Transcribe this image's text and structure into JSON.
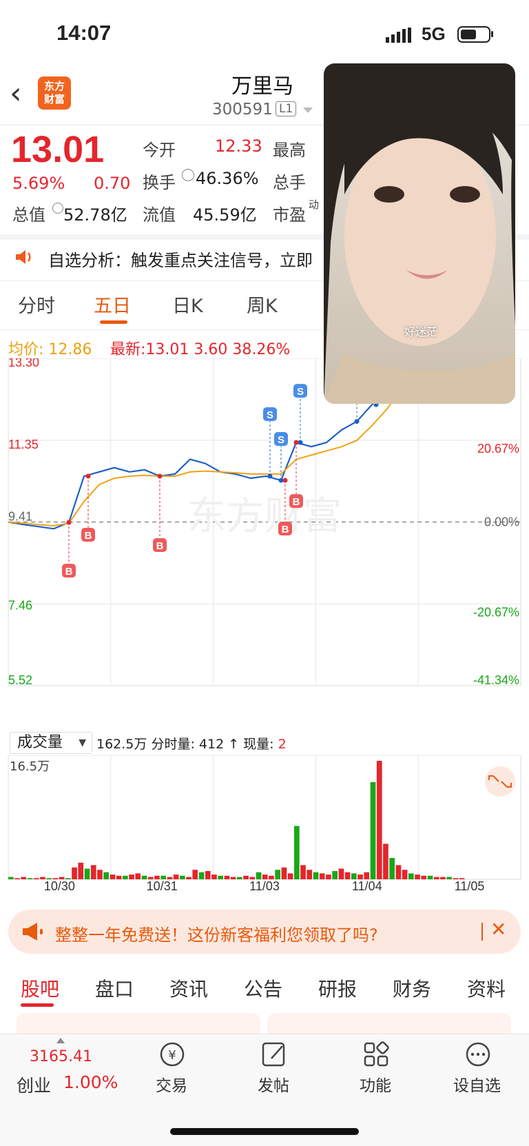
{
  "status_bar": {
    "time": "14:07",
    "network": "5G"
  },
  "header": {
    "logo_text": "东方财富",
    "stock_name": "万里马",
    "stock_code": "300591",
    "level": "L1"
  },
  "quote": {
    "price": "13.01",
    "change_pct": "5.69%",
    "change_abs": "0.70",
    "open_label": "今开",
    "open": "12.33",
    "high_label": "最高",
    "turnover_label": "换手",
    "turnover": "46.36%",
    "volume_label": "总手",
    "mcap_label": "总值",
    "mcap": "52.78亿",
    "float_label": "流值",
    "float_val": "45.59亿",
    "pe_label": "市盈",
    "pe_sup": "动"
  },
  "info_banner": {
    "text": "自选分析：触发重点关注信号，立即"
  },
  "chart_tabs": [
    "分时",
    "五日",
    "日K",
    "周K"
  ],
  "chart_header": {
    "avg_label": "均价:",
    "avg": "12.86",
    "latest_label": "最新:",
    "latest": "13.01",
    "change": "3.60",
    "change_pct": "38.26%"
  },
  "chart_data": {
    "type": "line",
    "x_labels": [
      "10/30",
      "10/31",
      "11/03",
      "11/04",
      "11/05"
    ],
    "y_left_ticks": [
      "13.30",
      "11.35",
      "9.41",
      "7.46",
      "5.52"
    ],
    "y_right_ticks": [
      "20.67%",
      "0.00%",
      "-20.67%",
      "-41.34%"
    ],
    "ylim": [
      5.52,
      13.3
    ],
    "prev_close": 9.41,
    "series": [
      {
        "values": [
          9.41,
          9.35,
          9.3,
          9.25,
          9.4,
          10.5,
          10.6,
          10.7,
          10.6,
          10.65,
          10.5,
          10.55,
          10.9,
          10.8,
          10.6,
          10.55,
          10.45,
          10.5,
          10.4,
          11.3,
          11.2,
          11.3,
          11.6,
          11.8,
          12.2,
          12.6,
          13.1,
          13.2
        ]
      },
      {
        "values": [
          9.41,
          9.38,
          9.35,
          9.32,
          9.38,
          9.9,
          10.3,
          10.45,
          10.5,
          10.52,
          10.5,
          10.5,
          10.6,
          10.62,
          10.6,
          10.58,
          10.55,
          10.55,
          10.55,
          10.9,
          11.0,
          11.1,
          11.2,
          11.35,
          11.7,
          12.1,
          12.6,
          12.86
        ]
      }
    ],
    "markers": [
      {
        "type": "B",
        "i": 4
      },
      {
        "type": "B",
        "i": 5
      },
      {
        "type": "B",
        "i": 10
      },
      {
        "type": "B",
        "i": 18
      },
      {
        "type": "B",
        "i": 19
      },
      {
        "type": "S",
        "i": 17
      },
      {
        "type": "S",
        "i": 18
      },
      {
        "type": "S",
        "i": 19
      },
      {
        "type": "S",
        "i": 23
      },
      {
        "type": "S",
        "i": 24
      },
      {
        "type": "S",
        "i": 25
      },
      {
        "type": "S",
        "i": 26
      },
      {
        "type": "S",
        "i": 27
      }
    ],
    "watermark": "东方财富"
  },
  "volume_data": {
    "label": "成交量",
    "total": "162.5万",
    "minute_label": "分时量:",
    "minute": "412",
    "now_label": "现量:",
    "now": "2",
    "y_max": "16.5万",
    "bars": [
      2,
      1,
      2,
      1,
      1,
      2,
      1,
      1,
      2,
      1,
      10,
      14,
      9,
      12,
      8,
      6,
      4,
      3,
      3,
      4,
      5,
      3,
      2,
      3,
      3,
      2,
      4,
      3,
      2,
      8,
      6,
      7,
      4,
      3,
      3,
      2,
      2,
      3,
      2,
      6,
      4,
      3,
      8,
      10,
      5,
      45,
      12,
      8,
      6,
      5,
      4,
      7,
      9,
      6,
      5,
      4,
      6,
      82,
      100,
      30,
      18,
      12,
      8,
      5,
      4,
      3,
      3,
      2,
      2,
      2,
      1,
      1
    ]
  },
  "ad_banner": {
    "text": "整整一年免费送！这份新客福利您领取了吗?"
  },
  "bottom_tabs": [
    "股吧",
    "盘口",
    "资讯",
    "公告",
    "研报",
    "财务",
    "资料"
  ],
  "bottom_bar": {
    "index_value": "3165.41",
    "index_name": "创业",
    "index_pct": "1.00%",
    "trade": "交易",
    "post": "发帖",
    "func": "功能",
    "watch": "设自选"
  },
  "pip_video": {
    "caption": "好迷茫"
  },
  "colors": {
    "up": "#e3262c",
    "down": "#18a818",
    "accent": "#e85a0c",
    "price_line": "#1e5fc9",
    "avg_line": "#f2a114"
  }
}
